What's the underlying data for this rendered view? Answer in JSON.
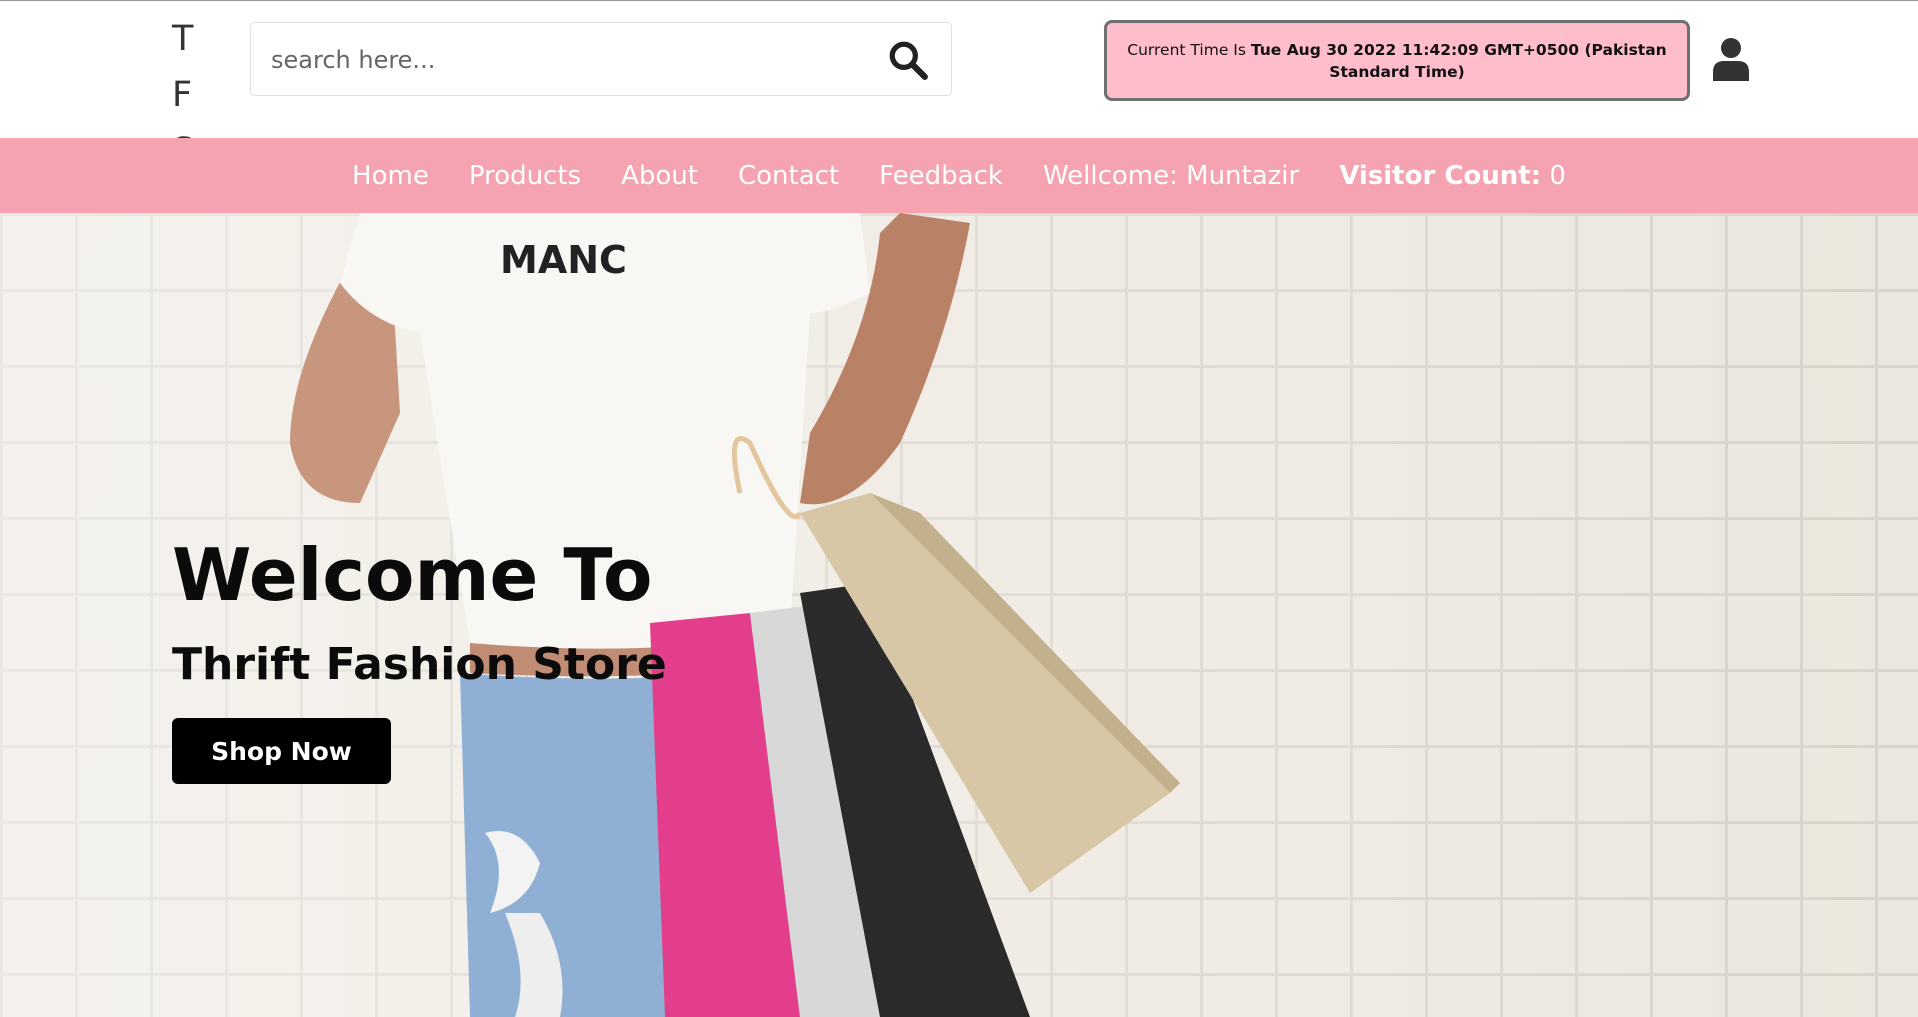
{
  "header": {
    "logo": "T F S",
    "search": {
      "placeholder": "search here...",
      "value": ""
    },
    "time": {
      "label": "Current Time Is",
      "value": "Tue Aug 30 2022 11:42:09 GMT+0500 (Pakistan Standard Time)"
    }
  },
  "nav": {
    "items": [
      "Home",
      "Products",
      "About",
      "Contact",
      "Feedback"
    ],
    "welcome": "Wellcome: Muntazir",
    "visitor_label": "Visitor Count:",
    "visitor_count": "0"
  },
  "hero": {
    "title": "Welcome To",
    "subtitle": "Thrift Fashion Store",
    "button": "Shop Now",
    "shirt_text": "MANC"
  },
  "colors": {
    "nav_bg": "#f5a3b0",
    "time_bg": "#ffbccb",
    "button_bg": "#000000"
  }
}
